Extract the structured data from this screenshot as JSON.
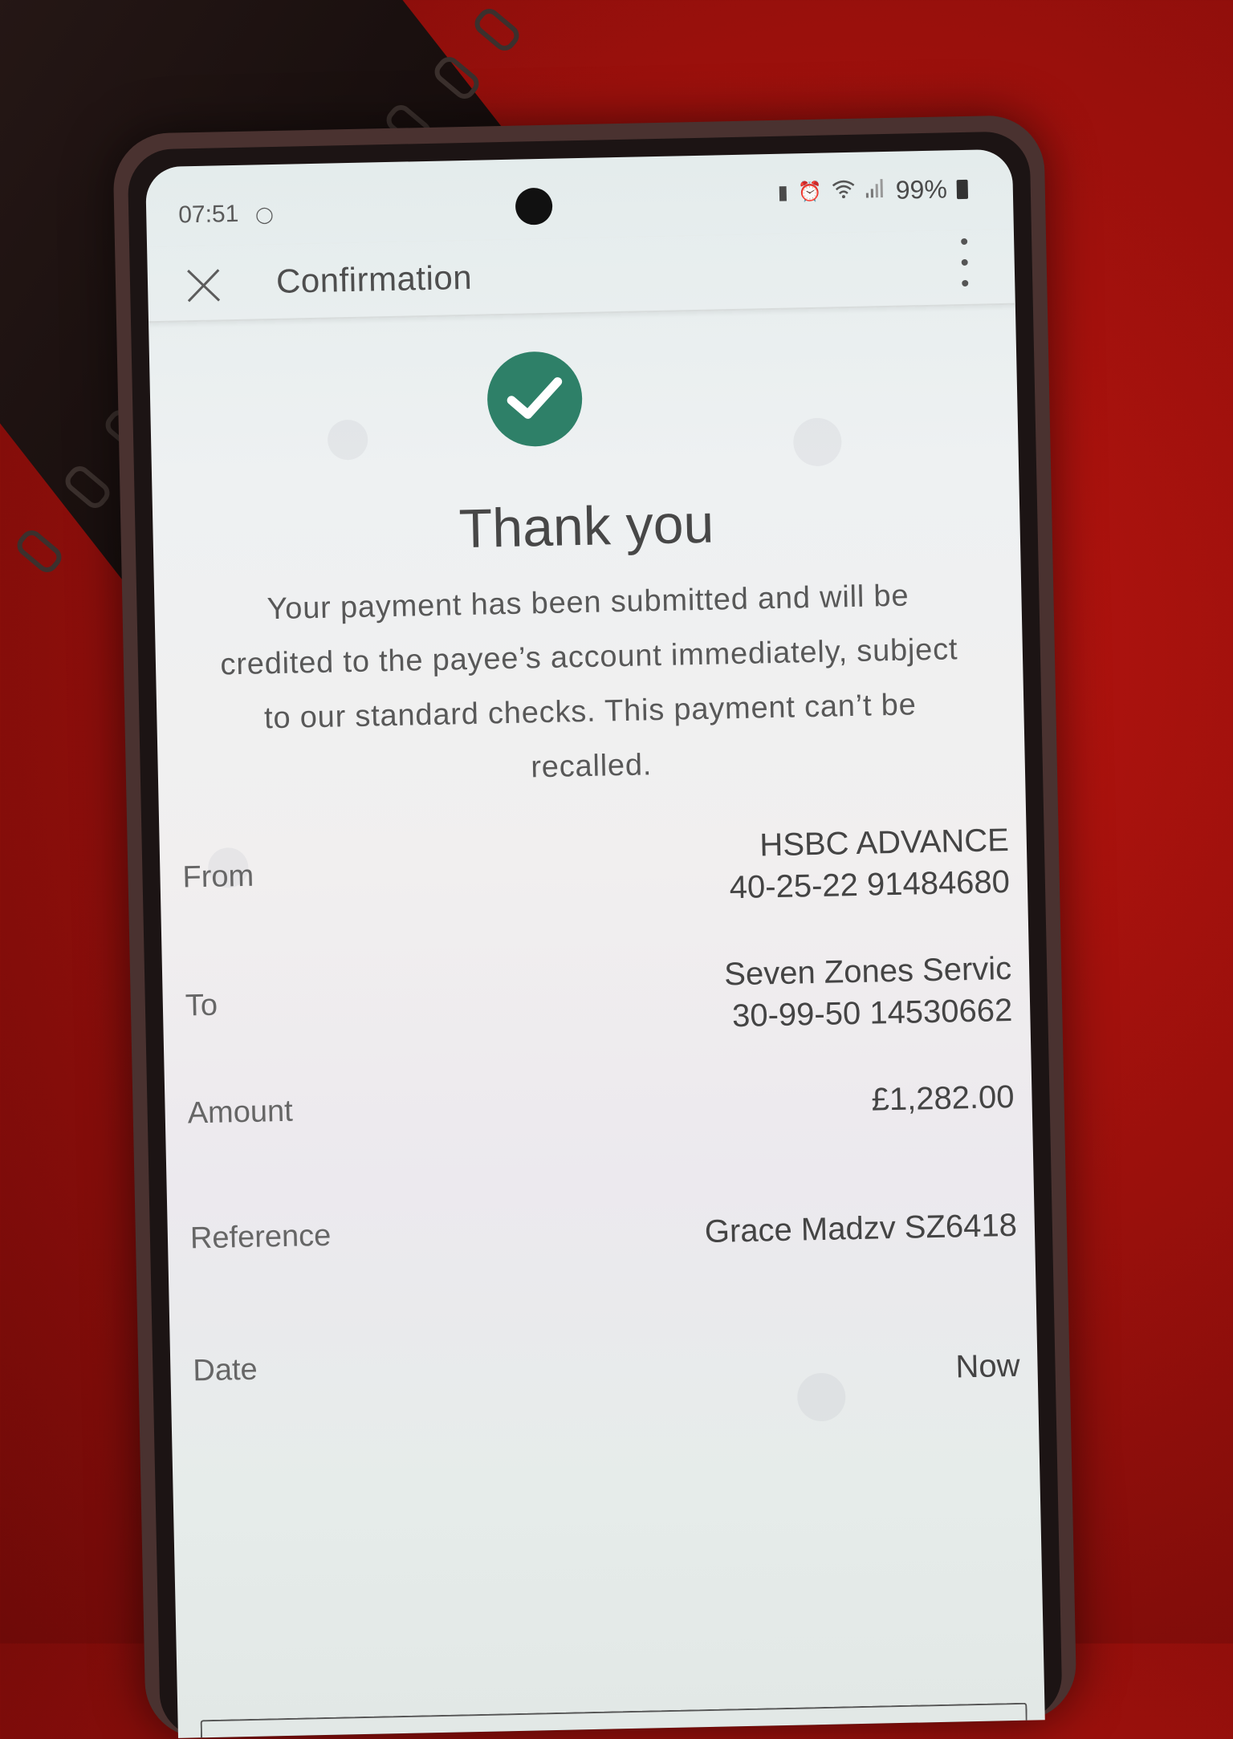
{
  "status_bar": {
    "time": "07:51",
    "battery": "99%",
    "icons": [
      "sim-icon",
      "alarm-icon",
      "wifi-icon",
      "signal-icon",
      "battery-icon"
    ]
  },
  "app_bar": {
    "title": "Confirmation",
    "close_icon": "close-icon",
    "menu_icon": "more-vertical-icon"
  },
  "confirmation": {
    "badge_icon": "check-circle-icon",
    "badge_color": "#2e8068",
    "heading": "Thank you",
    "message": "Your payment has been submitted and will be credited to the payee’s account immediately, subject to our standard checks. This payment can’t be recalled."
  },
  "details": {
    "from": {
      "label": "From",
      "line1": "HSBC ADVANCE",
      "line2": "40-25-22 91484680"
    },
    "to": {
      "label": "To",
      "line1": "Seven Zones Servic",
      "line2": "30-99-50 14530662"
    },
    "amount": {
      "label": "Amount",
      "value": "£1,282.00"
    },
    "reference": {
      "label": "Reference",
      "value": "Grace Madzv SZ6418"
    },
    "date": {
      "label": "Date",
      "value": "Now"
    }
  }
}
